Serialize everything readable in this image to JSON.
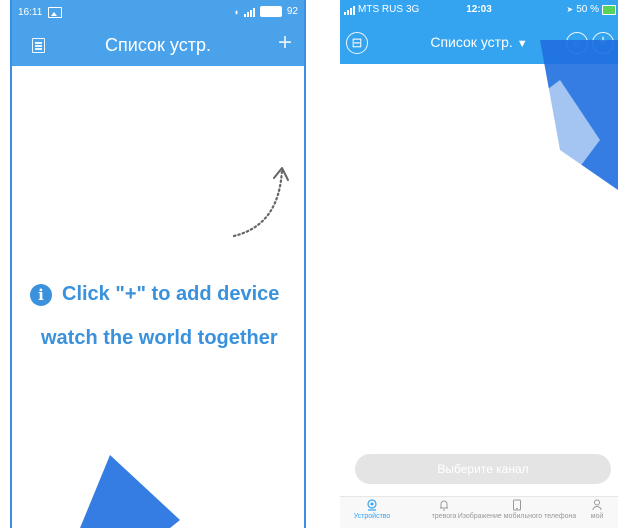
{
  "left_screen": {
    "status_bar": {
      "time": "16:11",
      "battery": "92"
    },
    "header": {
      "title": "Список устр.",
      "add_label": "+"
    },
    "hint": {
      "line1": "Click \"+\" to add device",
      "line2": "watch the world together",
      "info_glyph": "i"
    }
  },
  "right_screen": {
    "status_bar": {
      "carrier": "MTS RUS",
      "network": "3G",
      "time": "12:03",
      "battery": "50 %"
    },
    "header": {
      "title": "Список устр.",
      "caret": "▼",
      "add_label": "+"
    },
    "select_channel_label": "Выберите канал",
    "tabs": [
      {
        "label": "Устройство",
        "icon": "camera-icon",
        "active": true
      },
      {
        "label": "тревога",
        "icon": "bell-icon",
        "active": false
      },
      {
        "label": "Изображение мобильного телефона",
        "icon": "phone-icon",
        "active": false
      },
      {
        "label": "мой",
        "icon": "user-icon",
        "active": false
      }
    ]
  },
  "colors": {
    "accent": "#35a4f0",
    "hint_text": "#3a92dc",
    "button_disabled": "#e4e4e4",
    "watermark": "#1f6fe0"
  }
}
